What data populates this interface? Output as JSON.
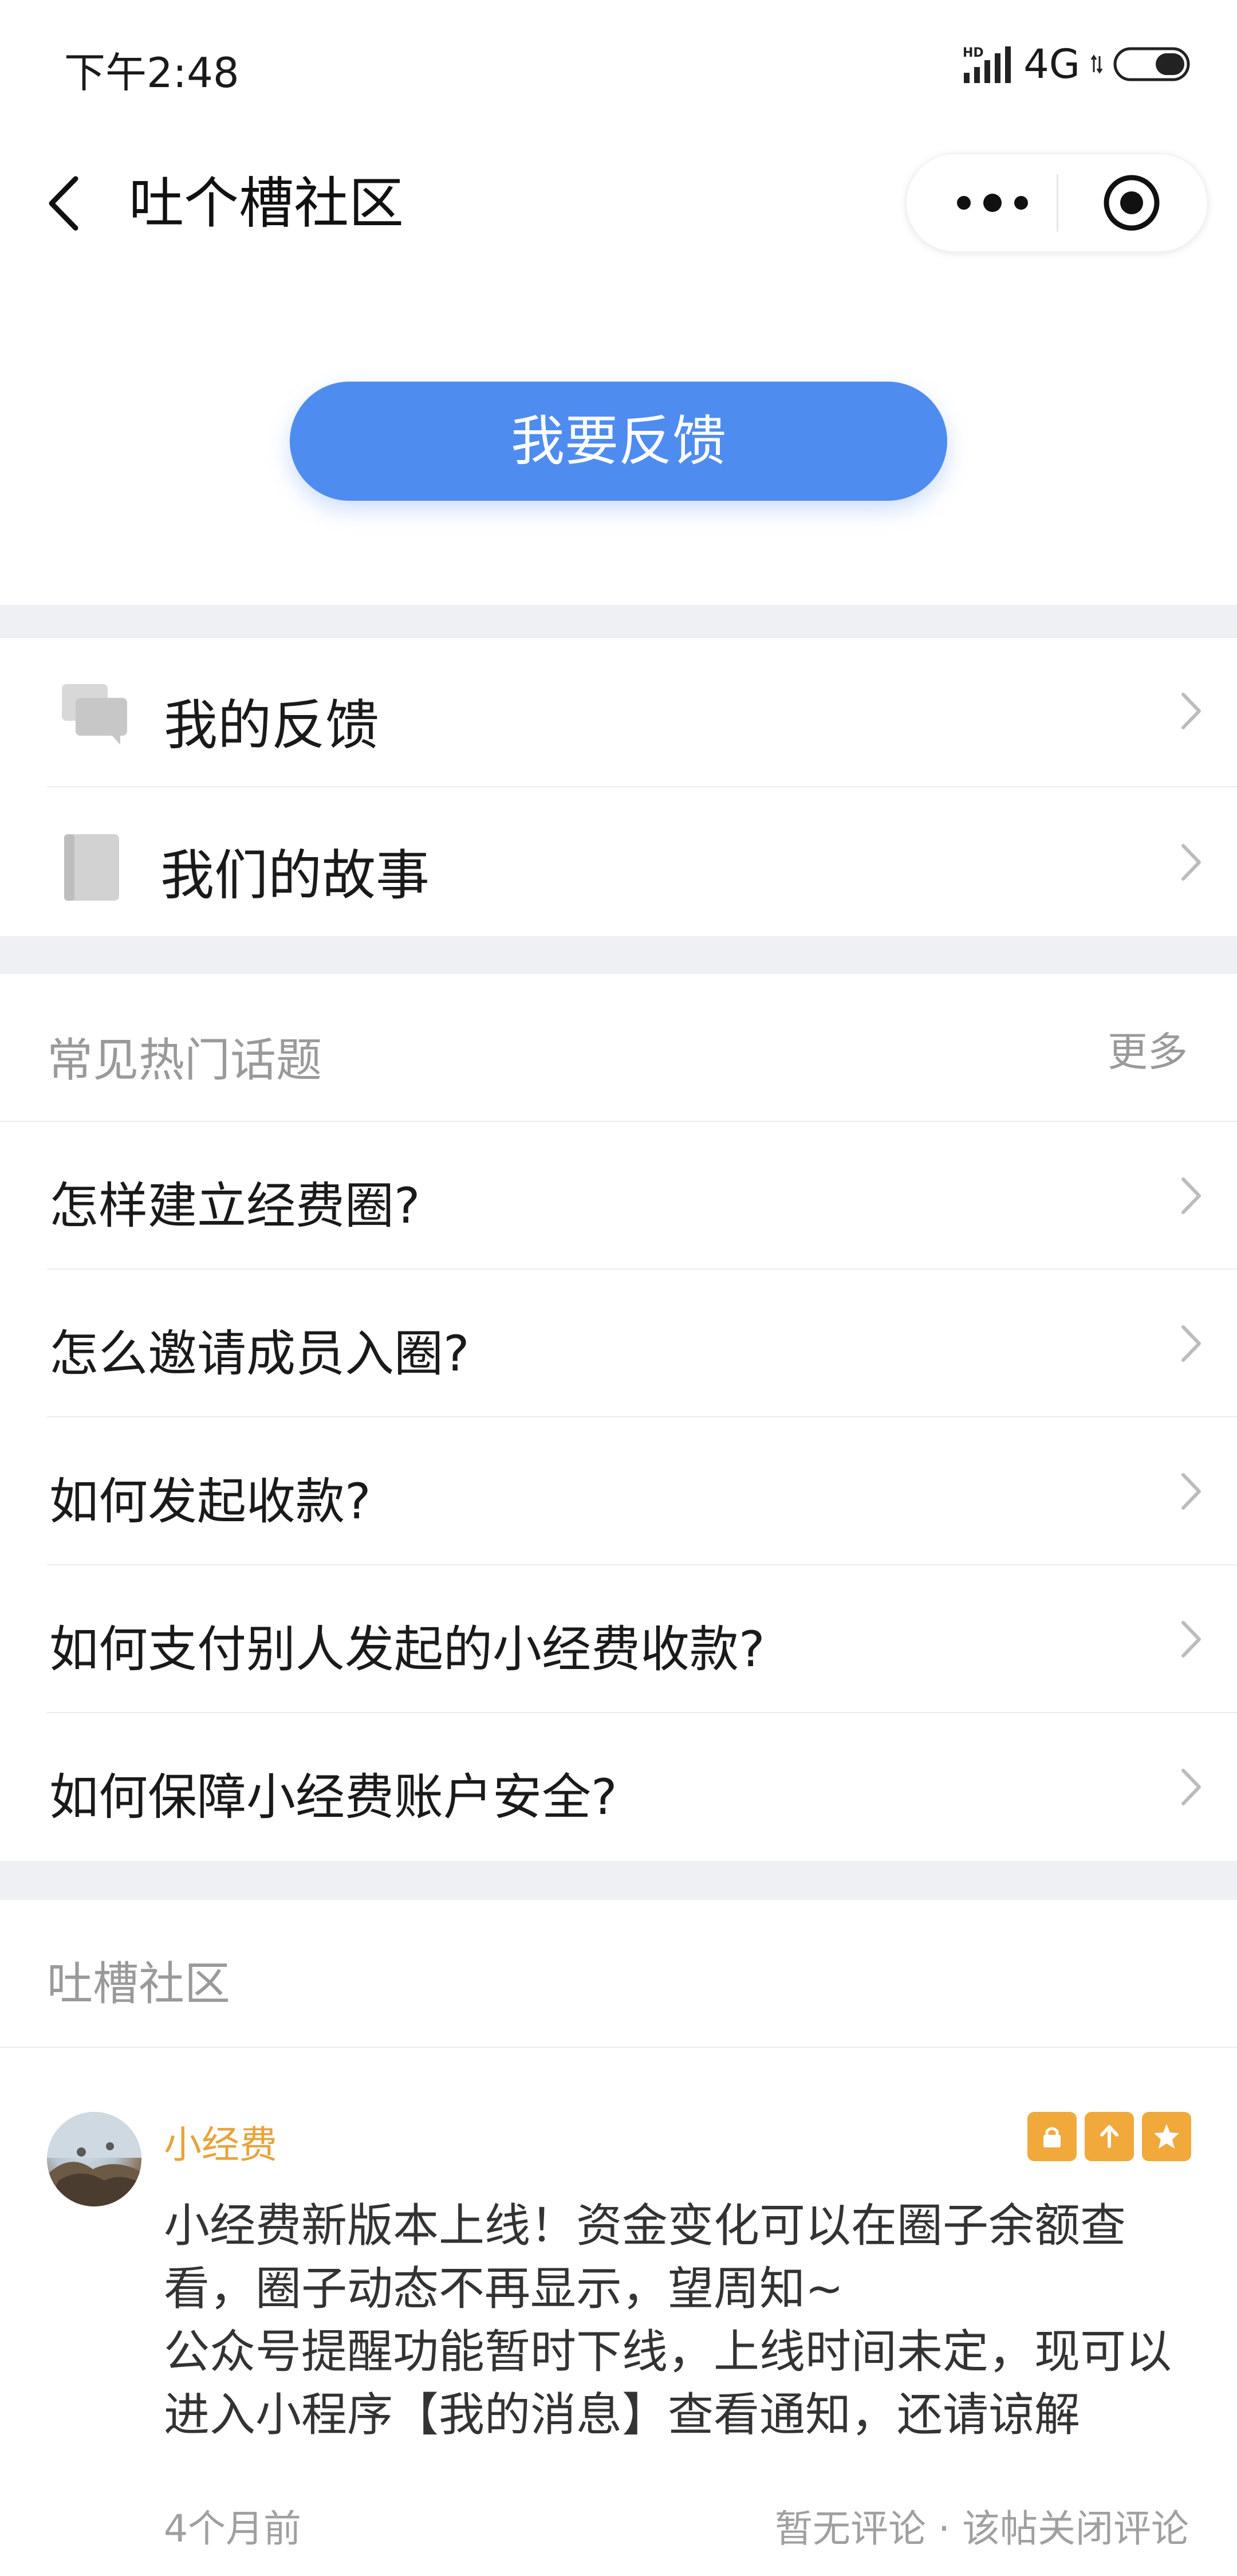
{
  "status_bar": {
    "time": "下午2:48",
    "network": "4G",
    "hd": "HD"
  },
  "nav": {
    "title": "吐个槽社区"
  },
  "feedback_button": "我要反馈",
  "menu": [
    {
      "label": "我的反馈",
      "icon": "chat-bubbles-icon"
    },
    {
      "label": "我们的故事",
      "icon": "book-icon"
    }
  ],
  "faq": {
    "title": "常见热门话题",
    "more": "更多",
    "topics": [
      "怎样建立经费圈?",
      "怎么邀请成员入圈?",
      "如何发起收款?",
      "如何支付别人发起的小经费收款?",
      "如何保障小经费账户安全?"
    ]
  },
  "community": {
    "title": "吐槽社区",
    "post": {
      "author": "小经费",
      "badges": [
        "lock-icon",
        "pin-top-icon",
        "star-icon"
      ],
      "lines": [
        "小经费新版本上线！资金变化可以在圈子余额查",
        "看，圈子动态不再显示，望周知~",
        "公众号提醒功能暂时下线，上线时间未定，现可以",
        "进入小程序【我的消息】查看通知，还请谅解"
      ],
      "time": "4个月前",
      "meta": "暂无评论 · 该帖关闭评论"
    }
  },
  "colors": {
    "accent": "#4f8cf0",
    "author": "#e6a43c",
    "badge": "#f0a93a"
  }
}
